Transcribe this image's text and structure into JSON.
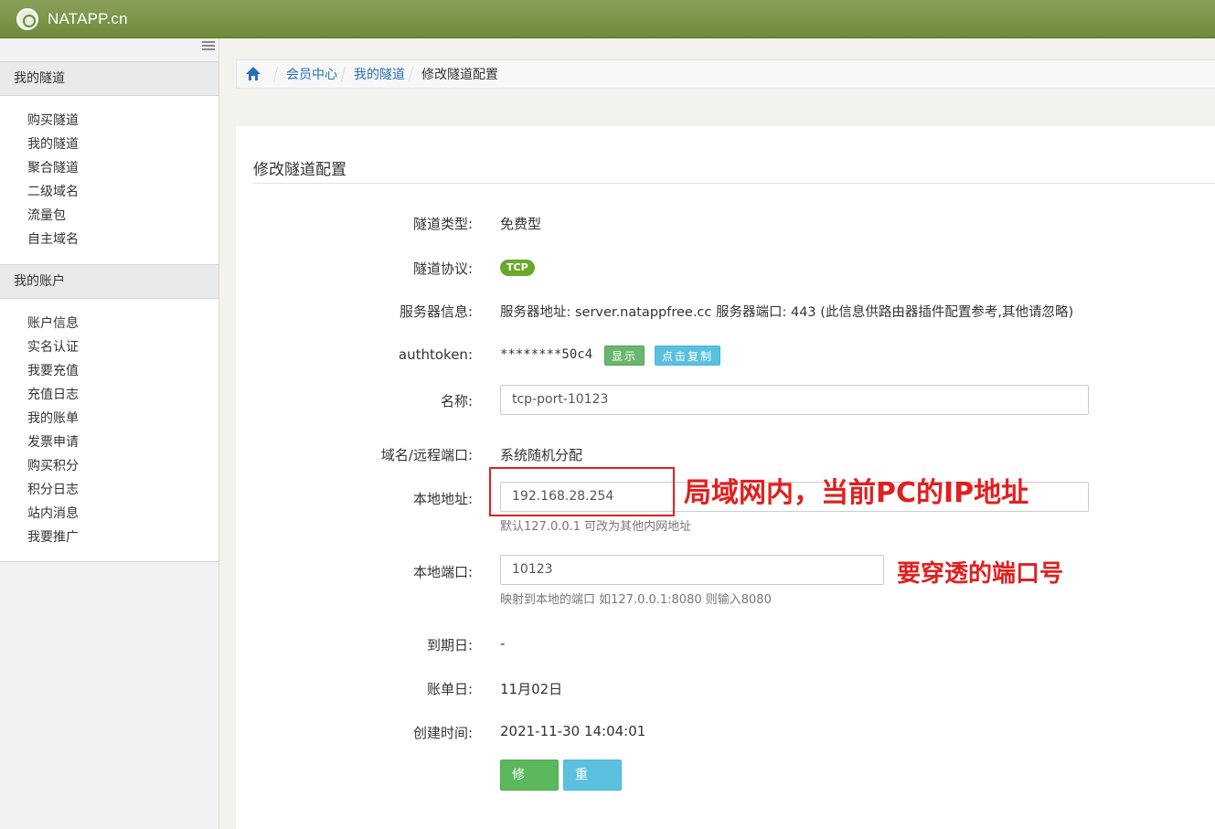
{
  "navbar": {
    "brand": "NATAPP.cn"
  },
  "sidebar": {
    "sections": [
      {
        "title": "我的隧道",
        "items": [
          "购买隧道",
          "我的隧道",
          "聚合隧道",
          "二级域名",
          "流量包",
          "自主域名"
        ]
      },
      {
        "title": "我的账户",
        "items": [
          "账户信息",
          "实名认证",
          "我要充值",
          "充值日志",
          "我的账单",
          "发票申请",
          "购买积分",
          "积分日志",
          "站内消息",
          "我要推广"
        ]
      }
    ]
  },
  "breadcrumb": {
    "items": [
      "会员中心",
      "我的隧道",
      "修改隧道配置"
    ]
  },
  "panel": {
    "title": "修改隧道配置"
  },
  "form": {
    "tunnel_type": {
      "label": "隧道类型:",
      "value": "免费型"
    },
    "protocol": {
      "label": "隧道协议:",
      "value": "TCP",
      "color": "#6aa82c"
    },
    "server_info": {
      "label": "服务器信息:",
      "value": "服务器地址: server.natappfree.cc 服务器端口: 443 (此信息供路由器插件配置参考,其他请忽略)"
    },
    "authtoken": {
      "label": "authtoken:",
      "value": "********50c4",
      "show_button": "显示",
      "copy_button": "点击复制"
    },
    "name": {
      "label": "名称:",
      "value": "tcp-port-10123"
    },
    "domain_port": {
      "label": "域名/远程端口:",
      "value": "系统随机分配"
    },
    "local_address": {
      "label": "本地地址:",
      "value": "192.168.28.254",
      "help": "默认127.0.0.1 可改为其他内网地址"
    },
    "local_port": {
      "label": "本地端口:",
      "value": "10123",
      "help": "映射到本地的端口 如127.0.0.1:8080 则输入8080"
    },
    "expire_date": {
      "label": "到期日:",
      "value": "-"
    },
    "bill_date": {
      "label": "账单日:",
      "value": "11月02日"
    },
    "created_time": {
      "label": "创建时间:",
      "value": "2021-11-30 14:04:01"
    },
    "submit_button": "修改",
    "reset_button": "重置"
  },
  "annotations": {
    "local_address_note": "局域网内，当前PC的IP地址",
    "local_port_note": "要穿透的端口号",
    "color": "#e02020"
  }
}
